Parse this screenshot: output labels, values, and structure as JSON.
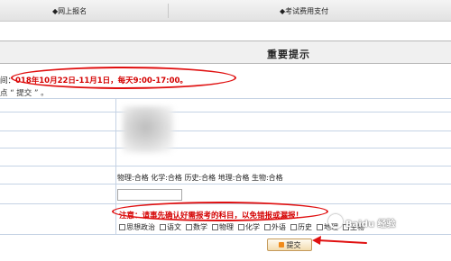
{
  "nav": {
    "tabs": [
      "◆网上报名",
      "◆考试费用支付"
    ]
  },
  "header": {
    "title": "重要提示"
  },
  "notice": {
    "line1_prefix": "间：",
    "line1_highlight": "018年10月22日-11月1日，每天9:00-17:00。",
    "line2": "点 “ 提交 ” 。"
  },
  "grades": "物理:合格 化学:合格 历史:合格 地理:合格 生物:合格",
  "warning": "注意：请事先确认好需报考的科目，以免错报或漏报！",
  "subjects": [
    "思想政治",
    "语文",
    "数学",
    "物理",
    "化学",
    "外语",
    "历史",
    "地理",
    "生物"
  ],
  "submit_label": "提交",
  "watermark": "Baidu 经验",
  "colors": {
    "accent_red": "#e01010",
    "grid_line": "#c4d2e4",
    "button_orange": "#f08a1a"
  }
}
